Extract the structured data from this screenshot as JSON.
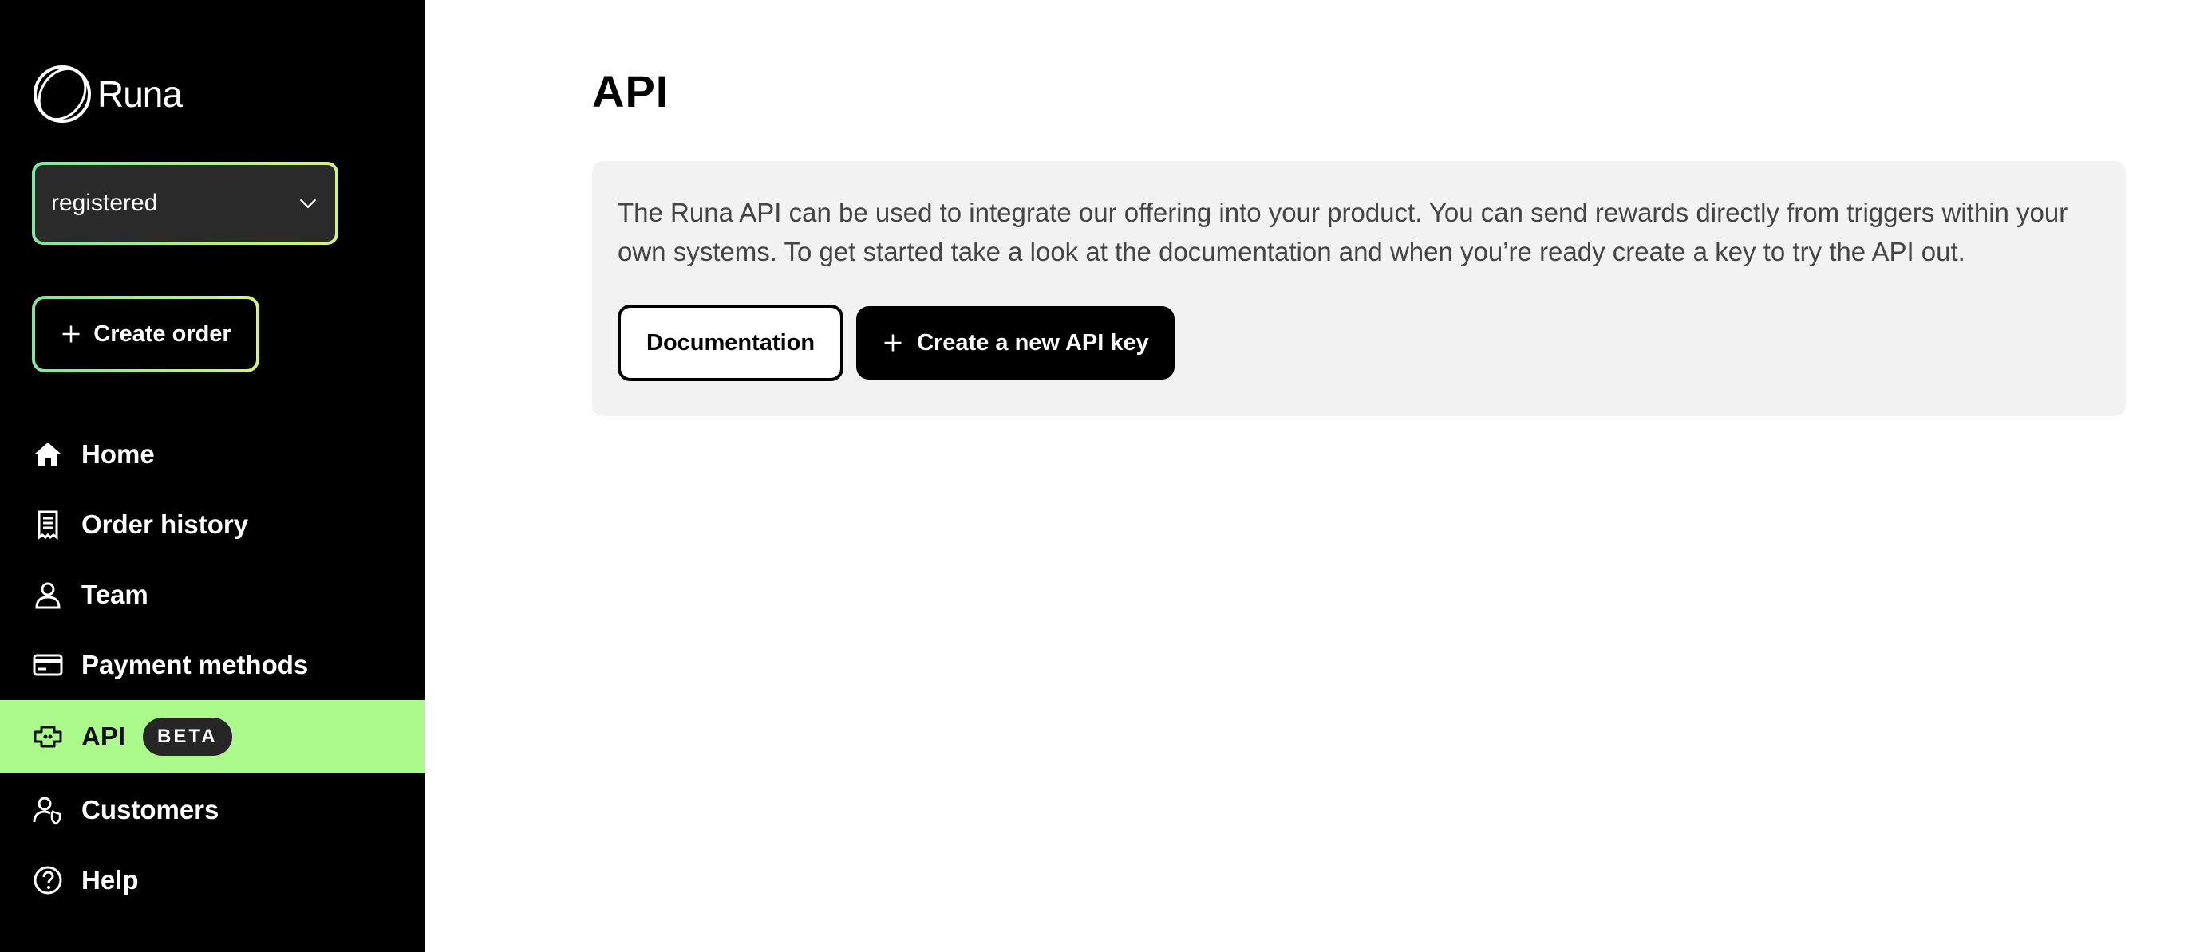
{
  "app": {
    "logo_text": "Runa"
  },
  "sidebar": {
    "org_select_value": "registered",
    "create_order_label": "Create order",
    "items": [
      {
        "label": "Home",
        "icon": "home-icon"
      },
      {
        "label": "Order history",
        "icon": "receipt-icon"
      },
      {
        "label": "Team",
        "icon": "person-icon"
      },
      {
        "label": "Payment methods",
        "icon": "card-icon"
      },
      {
        "label": "API",
        "icon": "plug-icon",
        "badge": "BETA",
        "active": true
      },
      {
        "label": "Customers",
        "icon": "customer-icon"
      },
      {
        "label": "Help",
        "icon": "help-icon"
      }
    ]
  },
  "main": {
    "title": "API",
    "description": "The Runa API can be used to integrate our offering into your product. You can send rewards directly from triggers within your own systems. To get started take a look at the documentation and when you’re ready create a key to try the API out.",
    "documentation_label": "Documentation",
    "create_key_label": "Create a new API key"
  },
  "colors": {
    "sidebar_bg": "#000000",
    "active_item_bg": "#adfa8c",
    "card_bg": "#f2f2f2",
    "accent_gradient_start": "#7fe6a0",
    "accent_gradient_end": "#d6f27a"
  }
}
